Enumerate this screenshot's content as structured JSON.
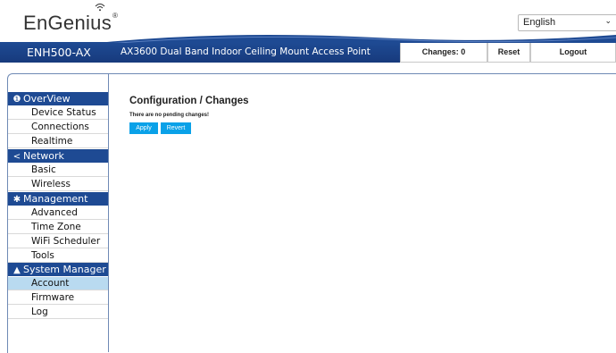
{
  "header": {
    "logo_text": "EnGenius",
    "logo_reg": "®",
    "language": "English",
    "accent": "#1e4a93"
  },
  "titlebar": {
    "model": "ENH500-AX",
    "description": "AX3600 Dual Band Indoor Ceiling Mount Access Point",
    "buttons": [
      "Changes: 0",
      "Reset",
      "Logout"
    ]
  },
  "sidebar": {
    "sections": [
      {
        "label": "OverView",
        "icon": "info-icon",
        "items": [
          "Device Status",
          "Connections",
          "Realtime"
        ]
      },
      {
        "label": "Network",
        "icon": "share-icon",
        "items": [
          "Basic",
          "Wireless"
        ]
      },
      {
        "label": "Management",
        "icon": "gear-icon",
        "items": [
          "Advanced",
          "Time Zone",
          "WiFi Scheduler",
          "Tools"
        ]
      },
      {
        "label": "System Manager",
        "icon": "user-icon",
        "items": [
          "Account",
          "Firmware",
          "Log"
        ]
      }
    ],
    "active_item": "Account"
  },
  "main": {
    "title": "Configuration / Changes",
    "message": "There are no pending changes!",
    "apply_label": "Apply",
    "revert_label": "Revert"
  }
}
